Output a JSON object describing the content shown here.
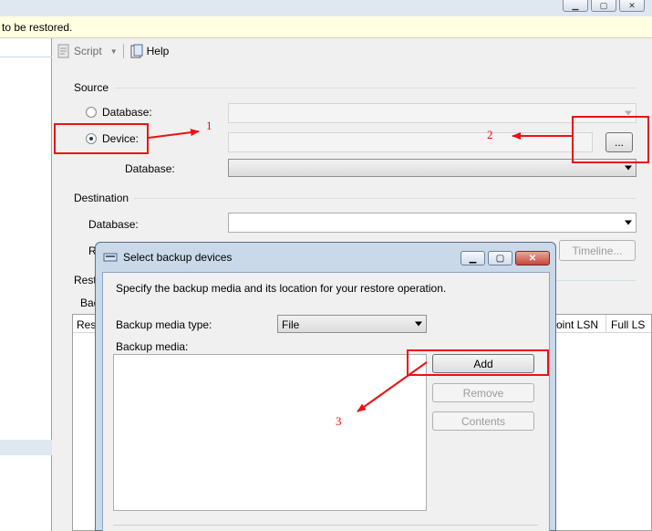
{
  "info_bar": {
    "text": "to be restored."
  },
  "toolbar": {
    "script_label": "Script",
    "help_label": "Help"
  },
  "source": {
    "heading": "Source",
    "database_radio_label": "Database:",
    "device_radio_label": "Device:",
    "browse_button_label": "...",
    "device_database_label": "Database:"
  },
  "destination": {
    "heading": "Destination",
    "database_label": "Database:",
    "partial_label": "R",
    "timeline_button_label": "Timeline..."
  },
  "restore_plan": {
    "heading_partial": "Rest",
    "backup_sets_partial": "Bac",
    "columns": [
      "Rest",
      "oint LSN",
      "Full LS"
    ]
  },
  "dialog": {
    "title": "Select backup devices",
    "description": "Specify the backup media and its location for your restore operation.",
    "media_type_label": "Backup media type:",
    "media_type_value": "File",
    "media_label": "Backup media:",
    "add_button_label": "Add",
    "remove_button_label": "Remove",
    "contents_button_label": "Contents"
  },
  "annotations": {
    "step1": "1",
    "step2": "2",
    "step3": "3",
    "color": "#ee1111"
  }
}
